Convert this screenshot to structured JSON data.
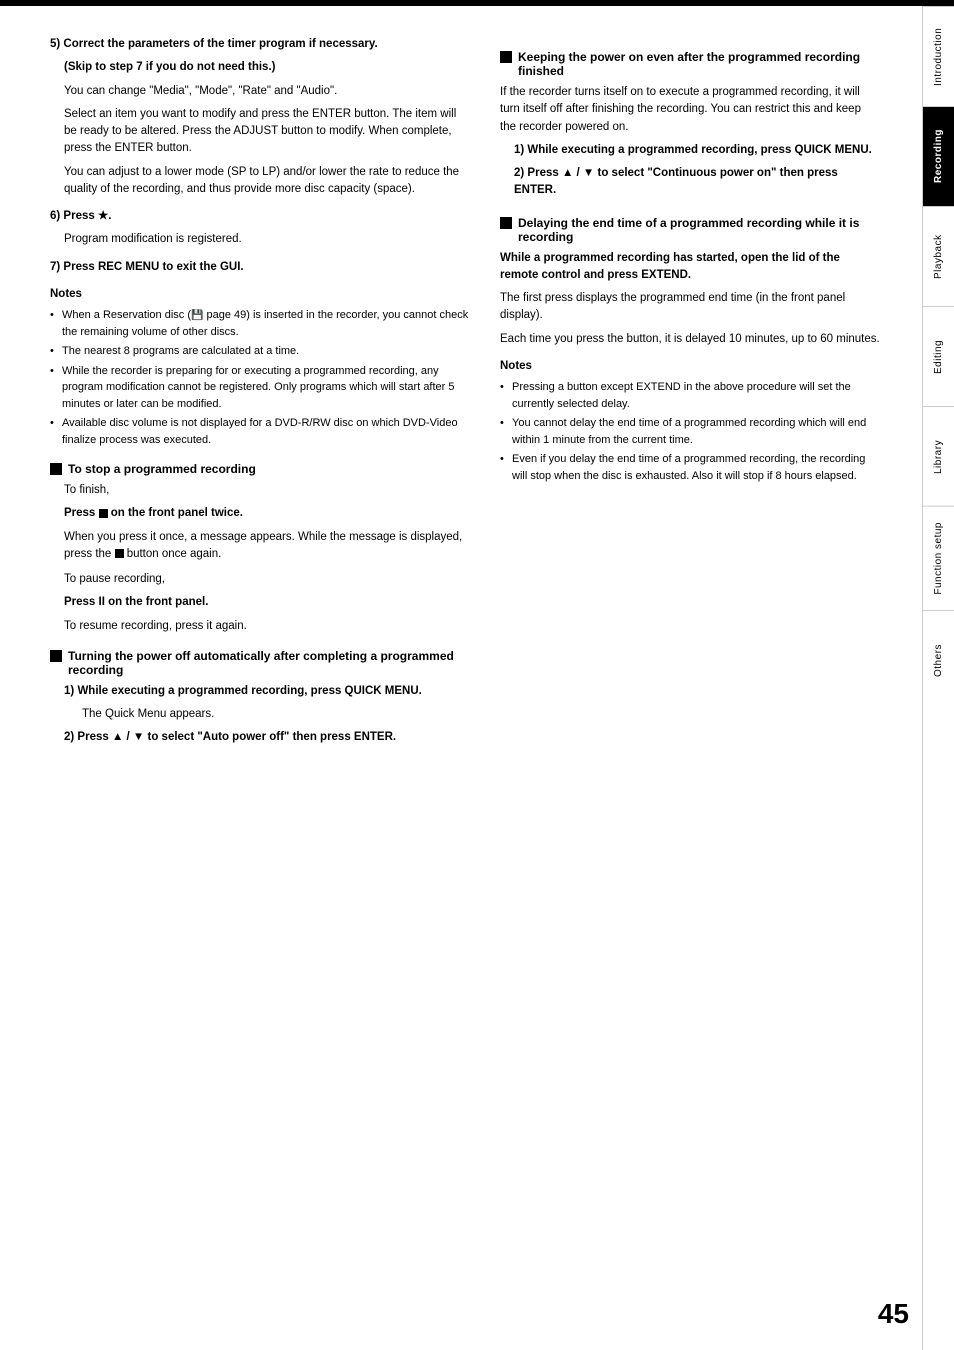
{
  "page": {
    "number": "45",
    "topbar": true
  },
  "sidebar": {
    "tabs": [
      {
        "label": "Introduction",
        "active": false
      },
      {
        "label": "Recording",
        "active": true
      },
      {
        "label": "Playback",
        "active": false
      },
      {
        "label": "Editing",
        "active": false
      },
      {
        "label": "Library",
        "active": false
      },
      {
        "label": "Function setup",
        "active": false
      },
      {
        "label": "Others",
        "active": false
      }
    ]
  },
  "left": {
    "step5": {
      "heading": "5)  Correct the parameters of the timer program if necessary.",
      "skip": "(Skip to step 7 if you do not need this.)",
      "para1": "You can change \"Media\", \"Mode\", \"Rate\" and \"Audio\".",
      "para2": "Select an item you want to modify and press the ENTER button. The item will be ready to be altered. Press the ADJUST button to modify. When complete, press the ENTER button.",
      "para3": "You can adjust to a lower mode (SP to LP) and/or lower the rate to reduce the quality of the recording, and thus provide more disc capacity (space)."
    },
    "step6": {
      "heading": "6)  Press ★.",
      "text": "Program modification is registered."
    },
    "step7": {
      "heading": "7)  Press REC MENU to exit the GUI."
    },
    "notes": {
      "title": "Notes",
      "items": [
        "When a Reservation disc (  page 49) is inserted in the recorder, you cannot check the remaining volume of other discs.",
        "The nearest 8 programs are calculated at a time.",
        "While the recorder is preparing for or executing a programmed recording, any program modification cannot be registered. Only programs which will start after 5 minutes or later can be modified.",
        "Available disc volume is not displayed for a DVD-R/RW disc on which DVD-Video finalize process was executed."
      ]
    },
    "stopSection": {
      "title": "To stop a programmed recording",
      "para1": "To finish,",
      "bold1": "Press ■ on the front panel twice.",
      "para2": "When you press it once, a message appears. While the message is displayed, press the ■ button once again.",
      "para3": "To pause recording,",
      "bold2": "Press II on the front panel.",
      "para4": "To resume recording, press it again."
    },
    "autoOffSection": {
      "title": "Turning the power off automatically after completing a programmed recording",
      "step1heading": "1)  While executing a programmed recording, press QUICK MENU.",
      "step1text": "The Quick Menu appears.",
      "step2heading": "2)  Press ▲ / ▼ to select \"Auto power off\" then press ENTER."
    }
  },
  "right": {
    "keepPowerSection": {
      "title": "Keeping the power on even after the programmed recording finished",
      "para1": "If the recorder turns itself on to execute a programmed recording, it will turn itself off after finishing the recording. You can restrict this and keep the recorder powered on.",
      "step1heading": "1)  While executing a programmed recording, press QUICK MENU.",
      "step2heading": "2)  Press ▲ / ▼ to select \"Continuous power on\" then press ENTER."
    },
    "delaySection": {
      "title": "Delaying the end time of a programmed recording while it is recording",
      "boldpara": "While a programmed recording has started, open the lid of the remote control and press EXTEND.",
      "para1": "The first press displays the programmed end time (in the front panel display).",
      "para2": "Each time you press the button, it is delayed 10 minutes, up to 60 minutes.",
      "notes": {
        "title": "Notes",
        "items": [
          "Pressing a button except EXTEND in the above procedure will set the currently selected delay.",
          "You cannot delay the end time of a programmed recording which will end within 1 minute from the current time.",
          "Even if you delay the end time of a programmed recording, the recording will stop when the disc is exhausted. Also it will stop if 8 hours elapsed."
        ]
      }
    }
  }
}
